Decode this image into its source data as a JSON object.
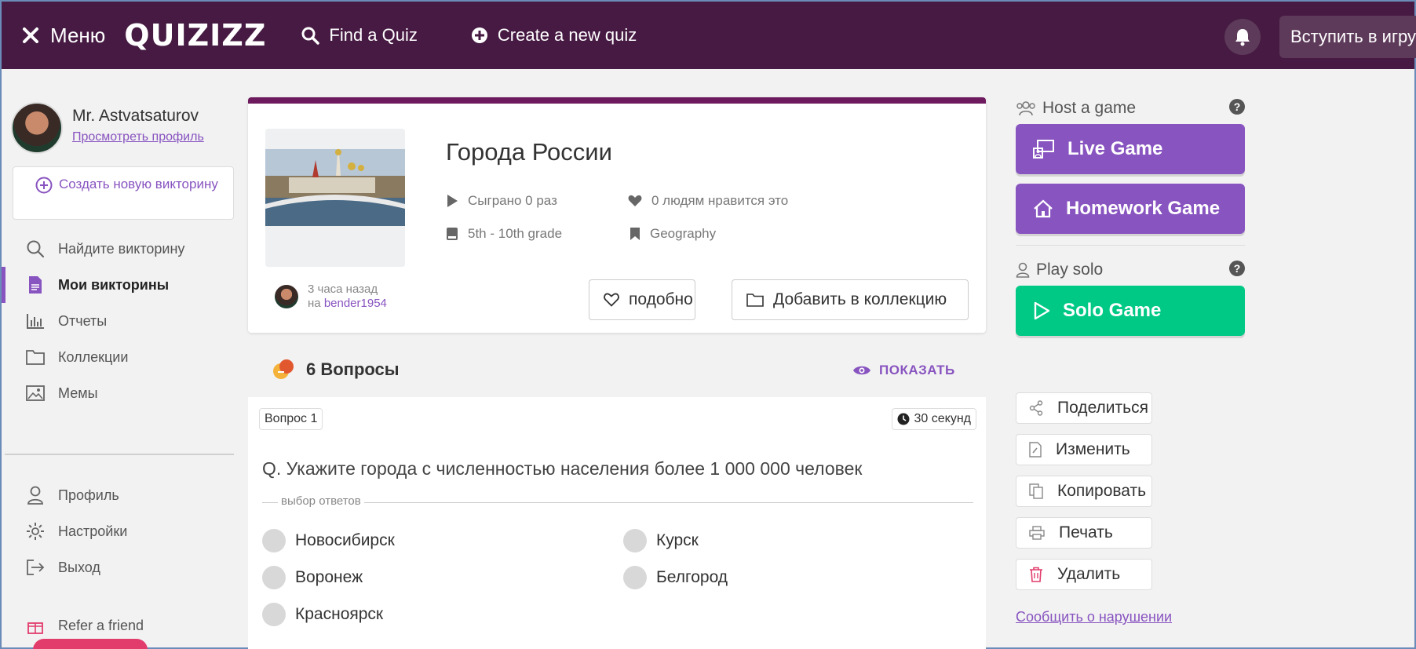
{
  "topbar": {
    "menu_label": "Меню",
    "logo": "QUIZIZZ",
    "find_quiz": "Find a Quiz",
    "create_quiz": "Create a new quiz",
    "join_button": "Вступить в игру!"
  },
  "sidebar": {
    "user_name": "Mr. Astvatsaturov",
    "view_profile": "Просмотреть профиль",
    "create_new": "Создать новую викторину",
    "items": [
      {
        "label": "Найдите викторину",
        "icon": "search-icon"
      },
      {
        "label": "Мои викторины",
        "icon": "document-icon",
        "active": true
      },
      {
        "label": "Отчеты",
        "icon": "bar-chart-icon"
      },
      {
        "label": "Коллекции",
        "icon": "folder-icon"
      },
      {
        "label": "Мемы",
        "icon": "image-icon"
      }
    ],
    "bottom_items": [
      {
        "label": "Профиль",
        "icon": "user-icon"
      },
      {
        "label": "Настройки",
        "icon": "gear-icon"
      },
      {
        "label": "Выход",
        "icon": "logout-icon"
      }
    ],
    "refer": "Refer a friend"
  },
  "quiz": {
    "title": "Города России",
    "played": "Сыграно 0 раз",
    "likes": "0 людям нравится это",
    "grade": "5th - 10th grade",
    "subject": "Geography",
    "time_ago": "3 часа назад",
    "by_prefix": "на",
    "author": "bender1954",
    "like_button": "подобно",
    "add_collection_button": "Добавить в коллекцию"
  },
  "questions_header": {
    "count_label": "6 Вопросы",
    "show_button": "ПОКАЗАТЬ"
  },
  "question": {
    "number": "Вопрос 1",
    "time": "30 секунд",
    "text": "Q. Укажите города с численностью населения более 1 000 000 человек",
    "section_label": "выбор ответов",
    "options": [
      "Новосибирск",
      "Курск",
      "Воронеж",
      "Белгород",
      "Красноярск"
    ]
  },
  "right": {
    "host_title": "Host a game",
    "live_game": "Live Game",
    "homework_game": "Homework Game",
    "solo_title": "Play solo",
    "solo_game": "Solo Game",
    "actions": [
      "Поделиться",
      "Изменить",
      "Копировать",
      "Печать",
      "Удалить"
    ],
    "report": "Сообщить о нарушении"
  },
  "colors": {
    "topbar": "#461a42",
    "accent": "#8854c0",
    "solo": "#00c985",
    "delete": "#e23c6c"
  }
}
